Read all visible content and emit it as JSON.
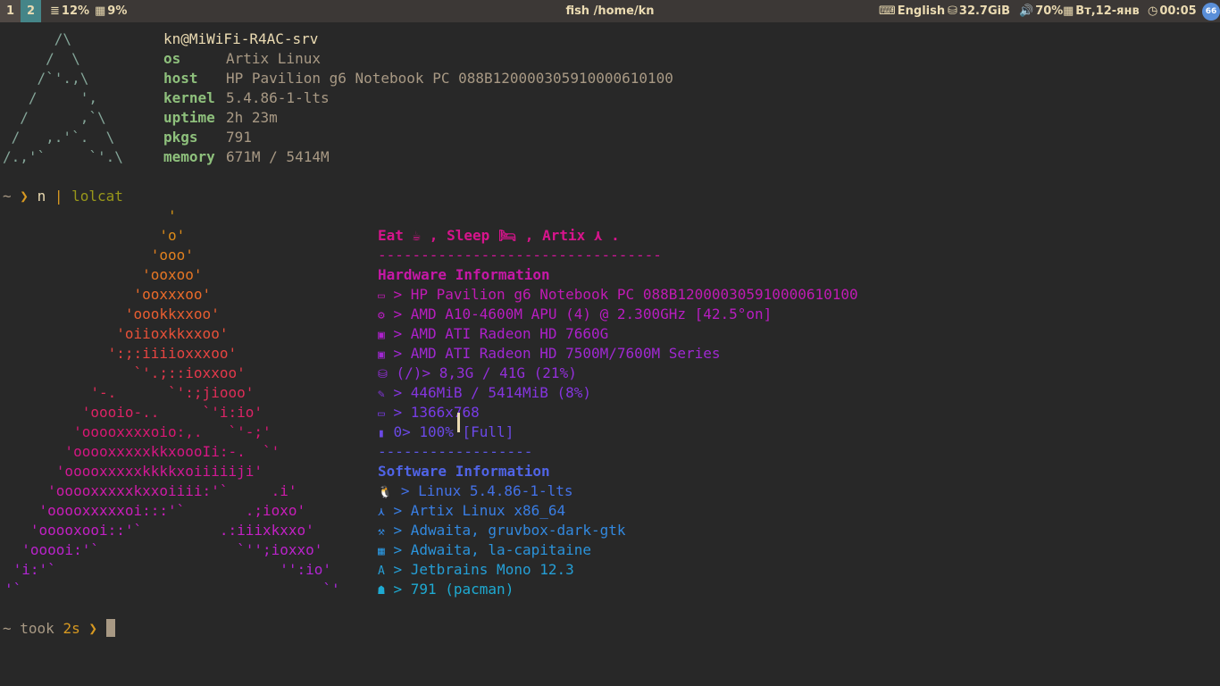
{
  "statusbar": {
    "workspaces": [
      "1",
      "2"
    ],
    "cpu": "12%",
    "mem": "9%",
    "window_title": "fish /home/kn",
    "layout": "English",
    "disk": "32.7GiB",
    "volume": "70%",
    "date": "Вт,12-янв",
    "time": "00:05",
    "tray_badge": "66"
  },
  "pfetch": {
    "logo": [
      "      /\\",
      "     /  \\",
      "    /`'.,\\",
      "   /     ',",
      "  /      ,`\\",
      " /   ,.'`.  \\",
      "/.,'`     `'.\\"
    ],
    "title": "kn@MiWiFi-R4AC-srv",
    "rows": [
      {
        "key": "os",
        "value": "Artix Linux"
      },
      {
        "key": "host",
        "value": "HP Pavilion g6 Notebook PC 088B120000305910000610100"
      },
      {
        "key": "kernel",
        "value": "5.4.86-1-lts"
      },
      {
        "key": "uptime",
        "value": "2h 23m"
      },
      {
        "key": "pkgs",
        "value": "791"
      },
      {
        "key": "memory",
        "value": "671M / 5414M"
      }
    ]
  },
  "prompt1": {
    "tilde": "~",
    "arrow": "❯",
    "cmd": "n",
    "pipe": "|",
    "arg": "lolcat"
  },
  "neofetch_art": [
    "                   '",
    "                  'o'",
    "                 'ooo'",
    "                'ooxoo'",
    "               'ooxxxoo'",
    "              'oookkxxoo'",
    "             'oiioxkkxxoo'",
    "            ':;:iiiioxxxoo'",
    "               `'.;::ioxxoo'",
    "          '-.      `':;jiooo'",
    "         'oooio-..     `'i:io'",
    "        'ooooxxxxoio:,.   `'-;'",
    "       'ooooxxxxxkkxoooIi:-.  `'",
    "      'ooooxxxxxkkkkxoiiiiiji'",
    "     'ooooxxxxxkxxoiiii:'`     .i'",
    "    'ooooxxxxxoi:::'`       .;ioxo'",
    "   'ooooxooi::'`         .:iiixkxxo'",
    "  'ooooi:'`                `'';ioxxo'",
    " 'i:'`                          '':io'",
    "'`                                   `'"
  ],
  "neofetch_info": [
    {
      "icon": "",
      "text": "Eat ☕ , Sleep 🛏 , Artix ⋏ ."
    },
    {
      "icon": "",
      "text": "---------------------------------"
    },
    {
      "icon": "",
      "text": "Hardware Information"
    },
    {
      "icon": "▭",
      "text": " > HP Pavilion g6 Notebook PC 088B120000305910000610100"
    },
    {
      "icon": "⚙",
      "text": " > AMD A10-4600M APU (4) @ 2.300GHz [42.5°on]"
    },
    {
      "icon": "▣",
      "text": " > AMD ATI Radeon HD 7660G"
    },
    {
      "icon": "▣",
      "text": " > AMD ATI Radeon HD 7500M/7600M Series"
    },
    {
      "icon": "⛁",
      "text": " (/)> 8,3G / 41G (21%)"
    },
    {
      "icon": "✎",
      "text": " > 446MiB / 5414MiB (8%)"
    },
    {
      "icon": "▭",
      "text": " > 1366x768"
    },
    {
      "icon": "▮",
      "text": " 0> 100% [Full]"
    },
    {
      "icon": "",
      "text": "------------------"
    },
    {
      "icon": "",
      "text": "Software Information"
    },
    {
      "icon": "🐧",
      "text": " > Linux 5.4.86-1-lts"
    },
    {
      "icon": "⋏",
      "text": " > Artix Linux x86_64"
    },
    {
      "icon": "⚒",
      "text": " > Adwaita, gruvbox-dark-gtk"
    },
    {
      "icon": "▦",
      "text": " > Adwaita, la-capitaine"
    },
    {
      "icon": "A",
      "text": " > Jetbrains Mono 12.3"
    },
    {
      "icon": "☗",
      "text": " > 791 (pacman)"
    }
  ],
  "prompt2": {
    "tilde": "~",
    "took": "took",
    "duration": "2s",
    "arrow": "❯"
  }
}
